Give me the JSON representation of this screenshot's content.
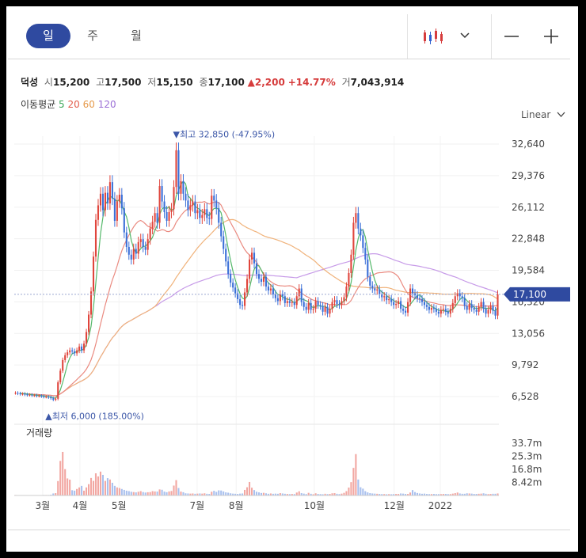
{
  "tabs": [
    {
      "label": "일",
      "active": true
    },
    {
      "label": "주",
      "active": false
    },
    {
      "label": "월",
      "active": false
    }
  ],
  "toolbar": {
    "chart_type_icon": "candlestick-icon",
    "dropdown_icon": "chevron-down-icon",
    "zoom_out_icon": "minus-icon",
    "zoom_in_icon": "plus-icon"
  },
  "stock": {
    "name": "덕성",
    "open_label": "시",
    "open": "15,200",
    "high_label": "고",
    "high": "17,500",
    "low_label": "저",
    "low": "15,150",
    "close_label": "종",
    "close": "17,100",
    "change": "▲2,200",
    "change_pct": "+14.77%",
    "volume_label": "거",
    "volume": "7,043,914"
  },
  "ma": {
    "label": "이동평균",
    "periods": [
      {
        "p": "5",
        "color": "#3aa757"
      },
      {
        "p": "20",
        "color": "#e25c4b"
      },
      {
        "p": "60",
        "color": "#e69a4b"
      },
      {
        "p": "120",
        "color": "#9b6fd6"
      }
    ]
  },
  "scale": {
    "label": "Linear"
  },
  "chart_data": {
    "type": "candlestick",
    "y_ticks": [
      "32,640",
      "29,376",
      "26,112",
      "22,848",
      "19,584",
      "16,320",
      "13,056",
      "9,792",
      "6,528"
    ],
    "ylim": [
      6528,
      32640
    ],
    "x_labels": [
      "3월",
      "4월",
      "5월",
      "7월",
      "8월",
      "10월",
      "12월",
      "2022"
    ],
    "high_annotation": "▼최고 32,850 (-47.95%)",
    "low_annotation": "▲최저 6,000 (185.00%)",
    "current_price": "17,100",
    "current_value": 17100,
    "high_value": 32850,
    "low_value": 6000,
    "volume_label": "거래량",
    "volume_ticks": [
      "33.7m",
      "25.3m",
      "16.8m",
      "8.42m"
    ],
    "volume_ylim": [
      0,
      33700000
    ],
    "close": [
      6900,
      6850,
      6800,
      6800,
      6750,
      6700,
      6700,
      6650,
      6650,
      6600,
      6600,
      6550,
      6500,
      6500,
      6450,
      6350,
      6200,
      6300,
      8000,
      9200,
      10300,
      10800,
      11100,
      11300,
      11200,
      11000,
      11300,
      11700,
      11300,
      12000,
      13200,
      15000,
      17400,
      21000,
      24800,
      26300,
      27500,
      25800,
      27600,
      26500,
      28700,
      27000,
      24700,
      26700,
      27400,
      26000,
      23500,
      22000,
      21200,
      20700,
      21800,
      21300,
      22500,
      22800,
      22000,
      21700,
      22800,
      23900,
      24600,
      25500,
      24500,
      28300,
      26700,
      25600,
      24700,
      25600,
      25900,
      28200,
      32000,
      27500,
      28800,
      27500,
      26800,
      25800,
      26300,
      26700,
      25500,
      25800,
      25000,
      25300,
      25900,
      25000,
      24900,
      27300,
      26800,
      26000,
      24500,
      23100,
      21800,
      20500,
      19200,
      18300,
      17800,
      17200,
      16600,
      16000,
      15900,
      17300,
      18700,
      20700,
      21400,
      20300,
      19200,
      18700,
      18400,
      18900,
      17900,
      17500,
      17700,
      17100,
      16700,
      16400,
      17100,
      16900,
      16200,
      16400,
      16200,
      16300,
      16000,
      16900,
      17700,
      16300,
      15800,
      15500,
      16200,
      15500,
      15600,
      16400,
      16000,
      15900,
      15300,
      15800,
      15100,
      15600,
      16300,
      16500,
      16100,
      16000,
      16400,
      16800,
      17900,
      19300,
      21200,
      24500,
      25500,
      23900,
      23200,
      21900,
      20700,
      18900,
      18000,
      17700,
      17500,
      17600,
      17100,
      16800,
      16900,
      16500,
      16600,
      16300,
      16000,
      16100,
      16400,
      15600,
      15400,
      15200,
      16300,
      17700,
      17200,
      17000,
      16700,
      16600,
      16300,
      16000,
      15800,
      15500,
      15700,
      15600,
      15300,
      15100,
      15500,
      15600,
      15300,
      15100,
      15600,
      16200,
      16900,
      17200,
      16900,
      16700,
      15900,
      15500,
      16100,
      15700,
      15500,
      15300,
      15800,
      16300,
      15600,
      15100,
      15500,
      15900,
      15400,
      14900,
      17100
    ],
    "volume": [
      0.3,
      0.25,
      0.2,
      0.2,
      0.2,
      0.2,
      0.15,
      0.15,
      0.2,
      0.2,
      0.25,
      0.2,
      0.3,
      0.3,
      0.3,
      0.5,
      1.3,
      1.5,
      9.3,
      22.3,
      28.1,
      17.0,
      11.0,
      10.2,
      3.4,
      3.1,
      4.2,
      5.2,
      6.2,
      3.1,
      5.2,
      7.3,
      11.3,
      9.4,
      14.3,
      12.3,
      15.4,
      13.3,
      9.4,
      11.2,
      10.3,
      8.2,
      6.2,
      5.2,
      4.8,
      4.2,
      3.6,
      3.1,
      2.8,
      2.4,
      2.2,
      2.0,
      2.4,
      2.8,
      2.2,
      1.9,
      2.1,
      2.2,
      2.8,
      2.6,
      2.5,
      3.9,
      3.7,
      2.5,
      2.1,
      2.6,
      2.9,
      6.4,
      9.9,
      4.8,
      2.5,
      2.1,
      1.4,
      1.3,
      1.2,
      1.3,
      1.1,
      1.2,
      1.3,
      1.2,
      1.4,
      1.1,
      1.0,
      2.4,
      3.0,
      2.3,
      3.3,
      3.2,
      2.6,
      2.0,
      1.8,
      1.4,
      1.2,
      1.1,
      1.0,
      1.2,
      1.3,
      3.6,
      5.3,
      8.7,
      5.0,
      3.5,
      2.4,
      2.0,
      1.6,
      1.7,
      1.4,
      1.1,
      1.3,
      1.1,
      1.2,
      1.1,
      1.5,
      1.3,
      1.1,
      1.0,
      0.9,
      1.0,
      0.9,
      1.9,
      2.7,
      1.5,
      1.2,
      0.9,
      1.7,
      1.1,
      0.8,
      1.4,
      1.0,
      0.9,
      0.8,
      1.1,
      0.9,
      1.0,
      1.4,
      1.5,
      1.1,
      0.9,
      1.2,
      1.7,
      2.8,
      5.1,
      8.6,
      17.8,
      26.7,
      10.3,
      5.3,
      4.4,
      2.8,
      2.0,
      1.5,
      1.3,
      1.2,
      1.1,
      1.0,
      0.9,
      0.9,
      0.8,
      0.9,
      0.8,
      0.9,
      1.0,
      1.0,
      1.3,
      1.2,
      1.0,
      1.0,
      1.9,
      3.5,
      2.2,
      1.6,
      1.3,
      1.1,
      1.2,
      1.0,
      0.9,
      0.9,
      1.0,
      0.9,
      0.9,
      0.9,
      1.0,
      1.0,
      0.9,
      0.9,
      1.2,
      1.5,
      1.9,
      1.3,
      1.1,
      1.1,
      1.4,
      1.3,
      1.2,
      1.0,
      1.0,
      1.1,
      1.2,
      1.4,
      1.1,
      0.9,
      1.0,
      1.1,
      1.1,
      1.3,
      7.0
    ]
  }
}
